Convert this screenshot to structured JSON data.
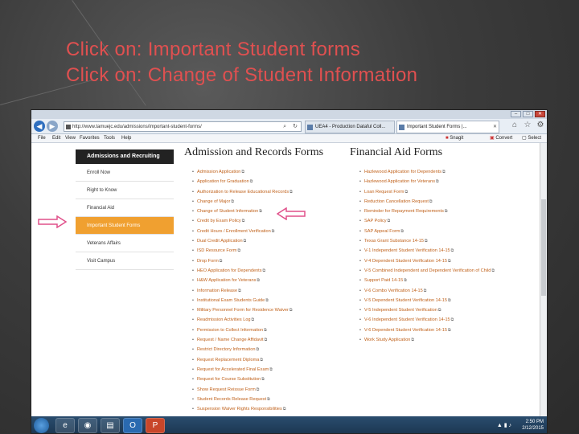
{
  "slide": {
    "title_line1": "Click on: Important Student forms",
    "title_line2": "Click on: Change of Student Information"
  },
  "browser": {
    "url": "http://www.tamuejc.edu/admissions/important-student-forms/",
    "tabs": [
      {
        "label": "UEA4 - Production Dataful Coll..."
      },
      {
        "label": "Important Student Forms |..."
      }
    ],
    "menu": [
      "File",
      "Edit",
      "View",
      "Favorites",
      "Tools",
      "Help"
    ],
    "commands": {
      "snagit": "Snagit",
      "convert": "Convert",
      "select": "Select"
    },
    "window_buttons": {
      "min": "–",
      "max": "□",
      "close": "✕"
    }
  },
  "sidebar": {
    "header": "Admissions and Recruiting",
    "items": [
      {
        "label": "Enroll Now"
      },
      {
        "label": "Right to Know"
      },
      {
        "label": "Financial Aid"
      },
      {
        "label": "Important Student Forms",
        "active": true
      },
      {
        "label": "Veterans Affairs"
      },
      {
        "label": "Visit Campus"
      }
    ]
  },
  "admission_forms": {
    "title": "Admission and Records Forms",
    "items": [
      "Admission Application",
      "Application for Graduation",
      "Authorization to Release Educational Records",
      "Change of Major",
      "Change of Student Information",
      "Credit by Exam Policy",
      "Credit Hours / Enrollment Verification",
      "Dual Credit Application",
      "ISD Resource Form",
      "Drop Form",
      "HEO Application for Dependents",
      "H&W Application for Veterans",
      "Information Release",
      "Institutional Exam Students Guide",
      "Military Personnel Form for Residence Waiver",
      "Readmission Activities Log",
      "Permission to Collect Information",
      "Request / Name Change Affidavit",
      "Restrict Directory Information",
      "Request Replacement Diploma",
      "Request for Accelerated Final Exam",
      "Request for Course Substitution",
      "Show Request Reissue Form",
      "Student Records Release Request",
      "Suspension Waiver Rights Responsibilities"
    ]
  },
  "financial_forms": {
    "title": "Financial Aid Forms",
    "items": [
      "Hazlewood Application for Dependents",
      "Hazlewood Application for Veterans",
      "Loan Request Form",
      "Reduction Cancellation Request",
      "Reminder for Repayment Requirements",
      "SAP Policy",
      "SAP Appeal Form",
      "Texas Grant Substance 14-15",
      "V-1 Independent Student Verification 14-15",
      "V-4 Dependent Student Verification 14-15",
      "V-5 Combined Independent and Dependent Verification of Child",
      "Support Paid 14-15",
      "V-6 Combo Verification 14-15",
      "V-5 Dependent Student Verification 14-15",
      "V-5 Independent Student Verification",
      "V-6 Independent Student Verification 14-15",
      "V-6 Dependent Student Verification 14-15",
      "Work Study Application"
    ]
  },
  "taskbar": {
    "time": "2:50 PM",
    "date": "2/12/2015",
    "apps": [
      "e",
      "◉",
      "▤",
      "O",
      "P"
    ]
  },
  "colors": {
    "accent_orange": "#f0a030",
    "link_color": "#c0611a",
    "title_red": "#e05050",
    "arrow_pink": "#e0508a"
  }
}
